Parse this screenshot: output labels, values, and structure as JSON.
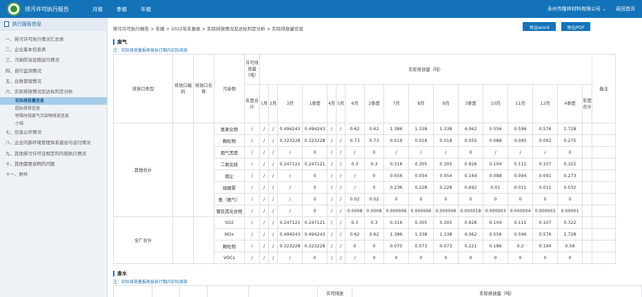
{
  "topbar": {
    "app_title": "排污许可执行报告",
    "nav": [
      "月报",
      "季报",
      "年报"
    ],
    "company": "永州市隆祥材料有限公司 ⌄",
    "back": "返回首页"
  },
  "sidebar": {
    "header": "执行报告信息",
    "items": [
      {
        "label": "一、排污许可执行情况汇总表"
      },
      {
        "label": "二、企业基本信息表"
      },
      {
        "label": "三、污染防治设施运行情况"
      },
      {
        "label": "四、自行监测情况"
      },
      {
        "label": "五、台账管理情况"
      },
      {
        "label": "六、实际排放情况及达标判定分析"
      }
    ],
    "subitems": [
      "实际排放量信息",
      "超标排放信息",
      "特殊时段废气污染物排放信息",
      "小结"
    ],
    "items_after": [
      {
        "label": "七、信息公开情况"
      },
      {
        "label": "八、企业内部环境管理体系建设与运行情况"
      },
      {
        "label": "九、其他排污许可证规定的内容执行情况"
      },
      {
        "label": "十、其他需要说明的问题"
      },
      {
        "label": "十一、附件"
      }
    ]
  },
  "main": {
    "breadcrumb": "排污许可执行报告 > 年报 > 2022年年报表 > 实际排放情况及达标判定分析 > 实际排放量信息",
    "export_word": "导出word",
    "export_pdf": "导出PDF",
    "section1_title": "废气",
    "section1_note": "注：实际排放量报表按执行期内实际排放",
    "section2_title": "废水",
    "section2_note": "注：实际排放量报表按执行期内实际排放"
  },
  "table": {
    "h_outlet_type": "排放口类型",
    "h_outlet_code": "排放口编码",
    "h_outlet_name": "排放口名称",
    "h_pollutant": "污染物",
    "h_permit": "许可排放量（吨）",
    "h_actual": "实际排放量（吨）",
    "h_remark": "备注",
    "periods": [
      "年度合计",
      "1月",
      "2月",
      "3月",
      "1季度",
      "4月",
      "5月",
      "6月",
      "2季度",
      "7月",
      "8月",
      "9月",
      "3季度",
      "10月",
      "11月",
      "12月",
      "4季度",
      "年度合计"
    ],
    "group1_label": "其他合计",
    "group1_rows": [
      {
        "pollutant": "氮氧化物",
        "values": [
          "/",
          "/",
          "/",
          "0.494243",
          "0.494243",
          "/",
          "/",
          "0.62",
          "0.62",
          "1.386",
          "1.338",
          "1.338",
          "4.062",
          "0.556",
          "0.596",
          "0.576",
          "1.728",
          ""
        ]
      },
      {
        "pollutant": "颗粒物",
        "values": [
          "/",
          "/",
          "/",
          "0.323228",
          "0.323228",
          "/",
          "/",
          "0.73",
          "0.73",
          "0.019",
          "0.018",
          "0.018",
          "0.055",
          "0.088",
          "0.095",
          "0.092",
          "0.275",
          ""
        ]
      },
      {
        "pollutant": "烟气黑度",
        "values": [
          "/",
          "/",
          "/",
          "/",
          "0",
          "/",
          "/",
          "/",
          "0",
          "/",
          "/",
          "/",
          "0",
          "/",
          "/",
          "/",
          "0",
          ""
        ]
      },
      {
        "pollutant": "二氧化硫",
        "values": [
          "/",
          "/",
          "/",
          "0.247121",
          "0.247121",
          "/",
          "/",
          "0.3",
          "0.3",
          "0.316",
          "0.305",
          "0.305",
          "0.926",
          "0.104",
          "0.111",
          "0.107",
          "0.322",
          ""
        ]
      },
      {
        "pollutant": "烟尘",
        "values": [
          "/",
          "/",
          "/",
          "/",
          "0",
          "/",
          "/",
          "/",
          "0",
          "0.056",
          "0.054",
          "0.054",
          "0.164",
          "0.088",
          "0.094",
          "0.091",
          "0.273",
          ""
        ]
      },
      {
        "pollutant": "硫酸雾",
        "values": [
          "/",
          "/",
          "/",
          "/",
          "0",
          "/",
          "/",
          "/",
          "0",
          "0.236",
          "0.228",
          "0.228",
          "0.692",
          "0.01",
          "0.011",
          "0.011",
          "0.032",
          ""
        ]
      },
      {
        "pollutant": "氨（氨气）",
        "values": [
          "/",
          "/",
          "/",
          "/",
          "0",
          "/",
          "/",
          "0.02",
          "0.02",
          "0",
          "0",
          "0",
          "0",
          "0",
          "0",
          "0",
          "0",
          ""
        ]
      },
      {
        "pollutant": "镍及其化合物",
        "values": [
          "/",
          "/",
          "/",
          "/",
          "0",
          "/",
          "/",
          "0.0008",
          "0.0008",
          "0.000006",
          "0.000006",
          "0.000006",
          "0.000018",
          "0.000003",
          "0.000004",
          "0.000003",
          "0.00001",
          ""
        ]
      }
    ],
    "group2_label": "全厂合计",
    "group2_rows": [
      {
        "pollutant": "SO2",
        "values": [
          "/",
          "/",
          "/",
          "0.247121",
          "0.247121",
          "/",
          "/",
          "0.3",
          "0.3",
          "0.316",
          "0.305",
          "0.305",
          "0.926",
          "0.104",
          "0.111",
          "0.107",
          "0.322",
          ""
        ]
      },
      {
        "pollutant": "NOx",
        "values": [
          "/",
          "/",
          "/",
          "0.494243",
          "0.494243",
          "/",
          "/",
          "0.62",
          "0.62",
          "1.386",
          "1.338",
          "1.338",
          "4.062",
          "0.556",
          "0.596",
          "0.576",
          "1.728",
          ""
        ]
      },
      {
        "pollutant": "颗粒物",
        "values": [
          "/",
          "/",
          "/",
          "0.323228",
          "0.323228",
          "/",
          "/",
          "0",
          "0",
          "0.075",
          "0.073",
          "0.073",
          "0.221",
          "0.186",
          "0.2",
          "0.194",
          "0.58",
          ""
        ]
      },
      {
        "pollutant": "VOCs",
        "values": [
          "/",
          "/",
          "/",
          "/",
          "0",
          "/",
          "/",
          "/",
          "0",
          "0",
          "0",
          "0",
          "0",
          "0",
          "0",
          "0",
          "0",
          ""
        ]
      }
    ],
    "water_permit": "许可排放",
    "water_actual": "实际排放量（吨）"
  }
}
